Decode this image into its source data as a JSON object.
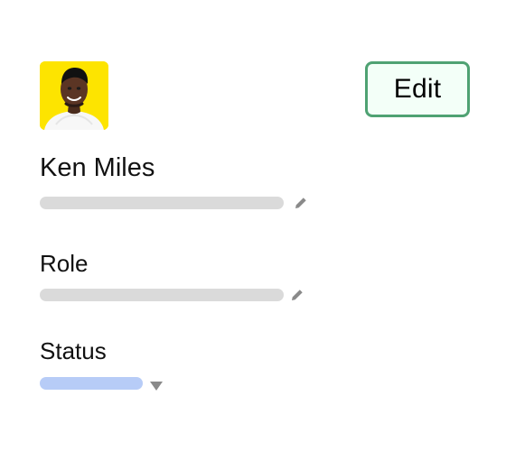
{
  "profile": {
    "name_label": "Ken Miles",
    "role_label": "Role",
    "status_label": "Status"
  },
  "actions": {
    "edit_label": "Edit"
  },
  "icons": {
    "avatar": "avatar-photo",
    "name_edit": "pencil-icon",
    "role_edit": "pencil-icon",
    "status_dropdown": "caret-down-icon"
  },
  "colors": {
    "avatar_background": "#FDE400",
    "edit_border": "#4FA273",
    "edit_background": "#F3FFF8",
    "placeholder_bar": "#DADADA",
    "status_bar": "#B7CCF7",
    "icon_gray": "#8A8A8A"
  }
}
